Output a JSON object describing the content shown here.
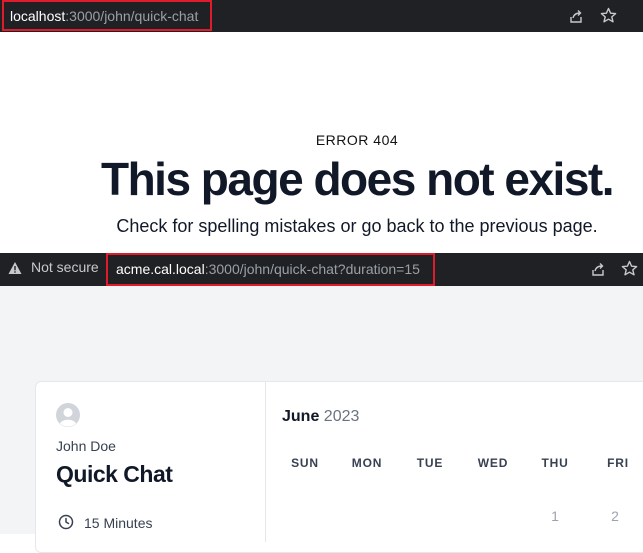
{
  "browser_top": {
    "url_host": "localhost",
    "url_rest": ":3000/john/quick-chat",
    "icons": [
      "share-icon",
      "star-icon"
    ]
  },
  "error_page": {
    "label": "ERROR 404",
    "title": "This page does not exist.",
    "subtitle": "Check for spelling mistakes or go back to the previous page."
  },
  "browser_bottom": {
    "security_text": "Not secure",
    "url_host": "acme.cal.local",
    "url_rest": ":3000/john/quick-chat?duration=15",
    "icons": [
      "share-icon",
      "star-icon"
    ]
  },
  "booking": {
    "user_name": "John Doe",
    "event_title": "Quick Chat",
    "duration": "15 Minutes",
    "month": "June",
    "year": "2023",
    "weekdays": [
      "SUN",
      "MON",
      "TUE",
      "WED",
      "THU",
      "FRI"
    ],
    "days": [
      "1",
      "2"
    ]
  },
  "colors": {
    "browser_bar": "#202124",
    "highlight_border": "#e01b2b",
    "page_background": "#f3f4f6"
  }
}
